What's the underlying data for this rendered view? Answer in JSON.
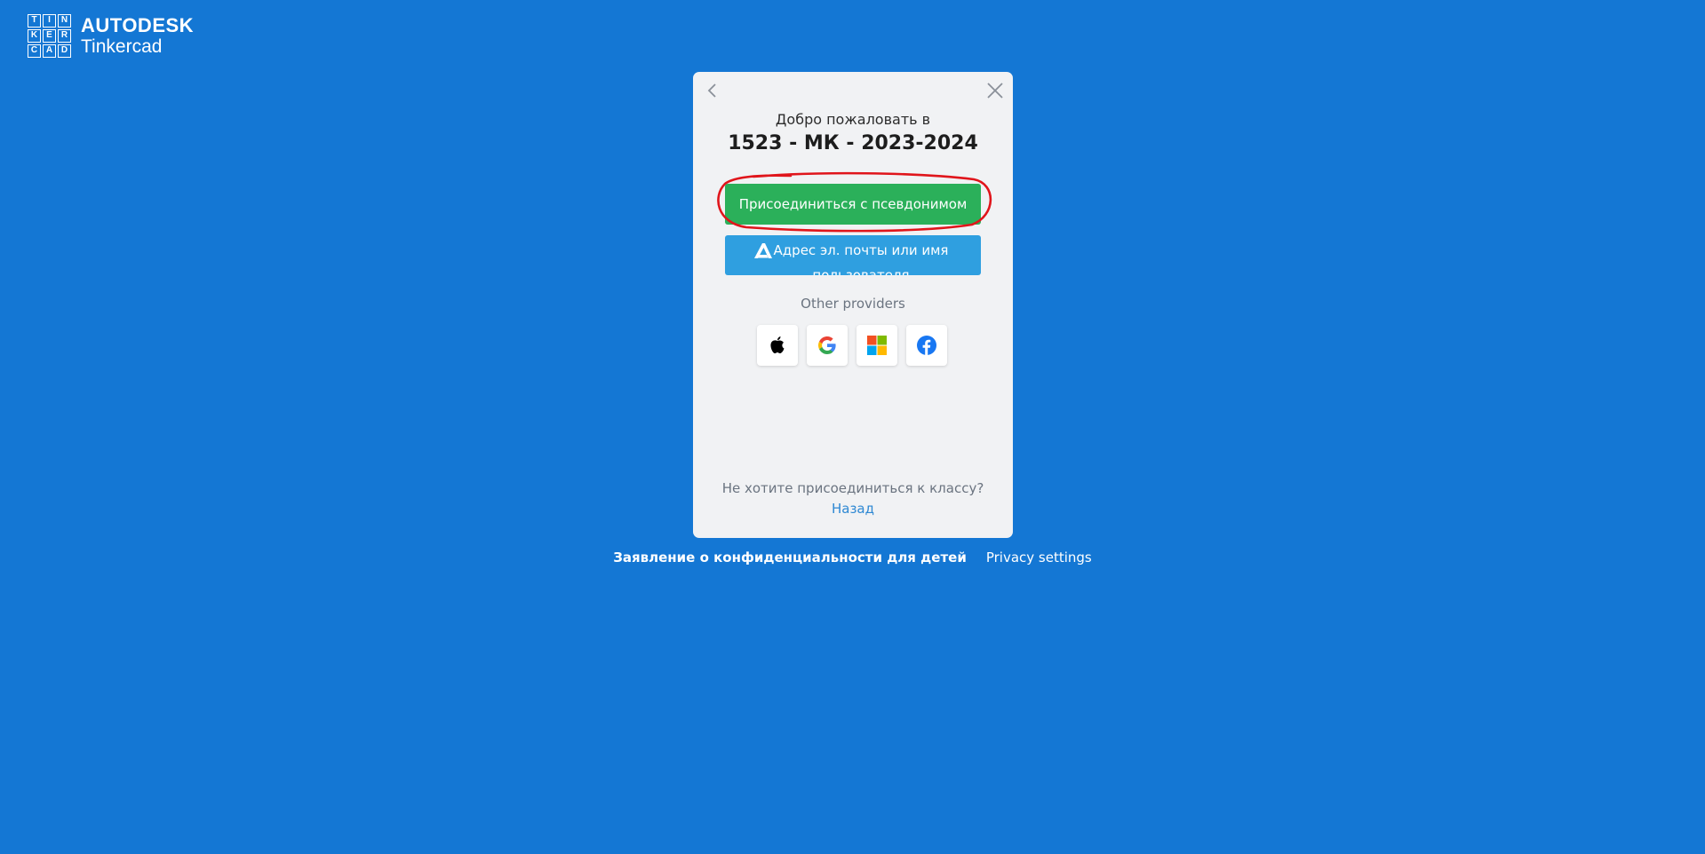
{
  "logo": {
    "letters": [
      "T",
      "I",
      "N",
      "K",
      "E",
      "R",
      "C",
      "A",
      "D"
    ],
    "brand": "AUTODESK",
    "product": "Tinkercad"
  },
  "modal": {
    "welcome_text": "Добро пожаловать в",
    "class_name": "1523 - МК - 2023-2024",
    "nickname_button": "Присоединиться с псевдонимом",
    "email_button": "Адрес эл. почты или имя пользователя",
    "other_providers_label": "Other providers",
    "providers": [
      {
        "icon": "apple-icon"
      },
      {
        "icon": "google-icon"
      },
      {
        "icon": "microsoft-icon"
      },
      {
        "icon": "facebook-icon"
      }
    ],
    "not_join_text": "Не хотите присоединиться к классу?",
    "back_link": "Назад"
  },
  "footer": {
    "kids_privacy": "Заявление о конфиденциальности для детей",
    "privacy_settings": "Privacy settings"
  },
  "colors": {
    "background": "#1477d4",
    "nickname_button": "#2bb05a",
    "email_button": "#2f9fe0",
    "annotation": "#e0151b"
  }
}
